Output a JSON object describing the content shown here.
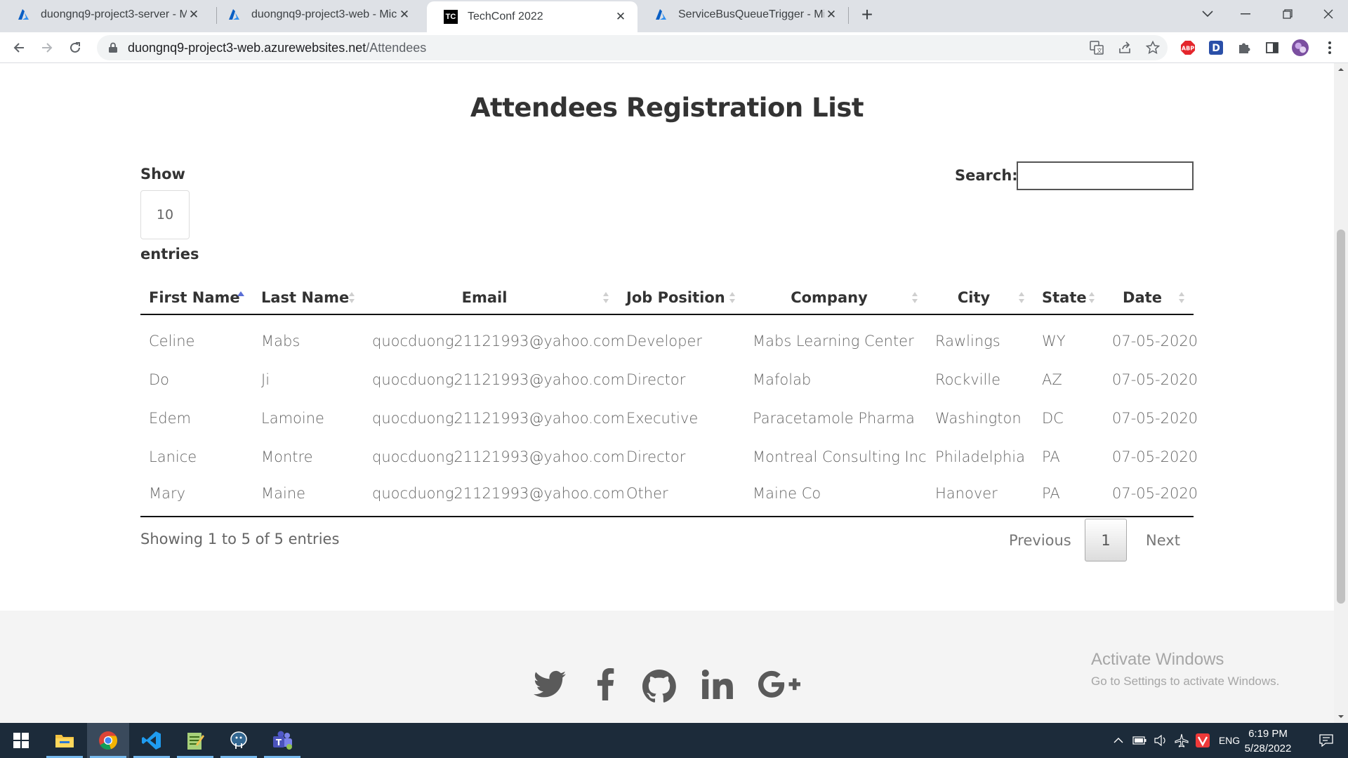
{
  "browser": {
    "tabs": [
      {
        "title": "duongnq9-project3-server - Micr",
        "favicon": "azure-icon",
        "active": false
      },
      {
        "title": "duongnq9-project3-web - Micro",
        "favicon": "azure-icon",
        "active": false
      },
      {
        "title": "TechConf 2022",
        "favicon": "techconf-icon",
        "favicon_text": "TC",
        "active": true
      },
      {
        "title": "ServiceBusQueueTrigger - Micros",
        "favicon": "azure-icon",
        "active": false
      }
    ],
    "url_host": "duongnq9-project3-web.azurewebsites.net",
    "url_path": "/Attendees"
  },
  "page": {
    "title": "Attendees Registration List",
    "show_label": "Show",
    "page_length": "10",
    "entries_label": "entries",
    "search_label": "Search:",
    "search_value": "",
    "columns": [
      "First Name",
      "Last Name",
      "Email",
      "Job Position",
      "Company",
      "City",
      "State",
      "Date"
    ],
    "sorted_column": "First Name",
    "sort_direction": "ascending",
    "rows": [
      [
        "Celine",
        "Mabs",
        "quocduong21121993@yahoo.com",
        "Developer",
        "Mabs Learning Center",
        "Rawlings",
        "WY",
        "07-05-2020"
      ],
      [
        "Do",
        "Ji",
        "quocduong21121993@yahoo.com",
        "Director",
        "Mafolab",
        "Rockville",
        "AZ",
        "07-05-2020"
      ],
      [
        "Edem",
        "Lamoine",
        "quocduong21121993@yahoo.com",
        "Executive",
        "Paracetamole Pharma",
        "Washington",
        "DC",
        "07-05-2020"
      ],
      [
        "Lanice",
        "Montre",
        "quocduong21121993@yahoo.com",
        "Director",
        "Montreal Consulting Inc",
        "Philadelphia",
        "PA",
        "07-05-2020"
      ],
      [
        "Mary",
        "Maine",
        "quocduong21121993@yahoo.com",
        "Other",
        "Maine Co",
        "Hanover",
        "PA",
        "07-05-2020"
      ]
    ],
    "info_text": "Showing 1 to 5 of 5 entries",
    "pagination": {
      "previous": "Previous",
      "current": "1",
      "next": "Next"
    },
    "social_icons": [
      "twitter-icon",
      "facebook-icon",
      "github-icon",
      "linkedin-icon",
      "google-plus-icon"
    ]
  },
  "watermark": {
    "title": "Activate Windows",
    "subtitle": "Go to Settings to activate Windows."
  },
  "taskbar": {
    "apps": [
      "start-icon",
      "file-explorer-icon",
      "chrome-icon",
      "vscode-icon",
      "notepad-icon",
      "postgres-icon",
      "teams-icon"
    ],
    "language": "ENG",
    "time": "6:19 PM",
    "date": "5/28/2022"
  },
  "colors": {
    "heading": "#333333",
    "cell_text": "#666666",
    "sort_active": "#5b6fd6",
    "taskbar": "#1c2b3a",
    "tabstrip": "#dee1e6"
  }
}
